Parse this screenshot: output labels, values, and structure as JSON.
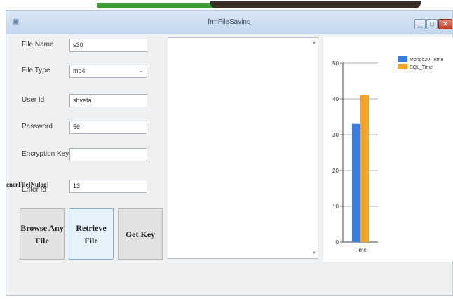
{
  "window": {
    "title": "frmFileSaving"
  },
  "form": {
    "file_name_label": "File Name",
    "file_name_value": "s30",
    "file_type_label": "File Type",
    "file_type_value": "mp4",
    "user_id_label": "User Id",
    "user_id_value": "shveta",
    "password_label": "Password",
    "password_value": "56",
    "encryption_key_label": "Encryption Key",
    "encryption_key_value": "",
    "enter_id_label": "Enter Id",
    "enter_id_value": "13",
    "overlay_text": "encrFile]Nulog]"
  },
  "buttons": {
    "browse": "Browse Any File",
    "retrieve": "Retrieve File",
    "get_key": "Get Key"
  },
  "colors": {
    "series_hmnp": "#3a7fe0",
    "series_sql": "#f5a524"
  },
  "chart_data": {
    "type": "bar",
    "categories": [
      "Time"
    ],
    "series": [
      {
        "name": "Mongo20_Time",
        "values": [
          33
        ]
      },
      {
        "name": "SQL_Time",
        "values": [
          41
        ]
      }
    ],
    "ylim": [
      0,
      50
    ],
    "yticks": [
      0,
      10,
      20,
      30,
      40,
      50
    ],
    "legend": "top-right",
    "grid": true
  }
}
